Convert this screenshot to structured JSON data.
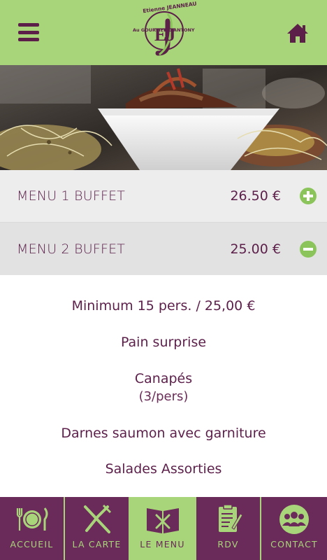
{
  "header": {
    "logo_name": "Etienne JEANNEAU",
    "logo_sub": "Au GOURMET D'ANTONY",
    "logo_initials": "EJ"
  },
  "menus": [
    {
      "name": "MENU 1 BUFFET",
      "price": "26.50 €",
      "toggle": "plus-icon"
    },
    {
      "name": "MENU 2 BUFFET",
      "price": "25.00 €",
      "toggle": "minus-icon"
    }
  ],
  "details": {
    "minimum": "Minimum 15 pers. / 25,00 €",
    "item1": "Pain surprise",
    "item2": "Canapés",
    "item2_sub": "(3/pers)",
    "item3": "Darnes saumon avec garniture",
    "item4": "Salades Assorties"
  },
  "nav": {
    "accueil": "ACCUEIL",
    "carte": "LA CARTE",
    "menu": "LE MENU",
    "rdv": "RDV",
    "contact": "CONTACT"
  },
  "colors": {
    "green": "#a9d57a",
    "purple": "#5c1f4a",
    "nav_purple": "#6b2b5a",
    "toggle_green": "#8bc45a"
  }
}
